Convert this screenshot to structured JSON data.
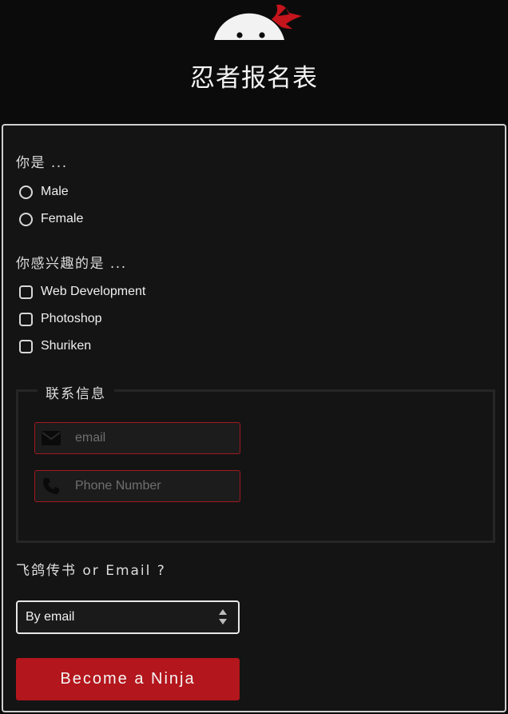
{
  "header": {
    "logo_icon": "ninja-head-with-red-bandana",
    "title": "忍者报名表"
  },
  "colors": {
    "accent": "#b3161c",
    "panel_bg": "#141414",
    "page_bg": "#0b0b0b"
  },
  "gender": {
    "question": "你是 ...",
    "options": [
      "Male",
      "Female"
    ]
  },
  "interests": {
    "question": "你感兴趣的是 ...",
    "options": [
      "Web Development",
      "Photoshop",
      "Shuriken"
    ]
  },
  "contact": {
    "legend": "联系信息",
    "email_placeholder": "email",
    "email_icon": "envelope-icon",
    "phone_placeholder": "Phone Number",
    "phone_icon": "phone-icon"
  },
  "preference": {
    "question": "飞鸽传书 or Email ?",
    "selected": "By email"
  },
  "submit": {
    "label": "Become a Ninja"
  }
}
